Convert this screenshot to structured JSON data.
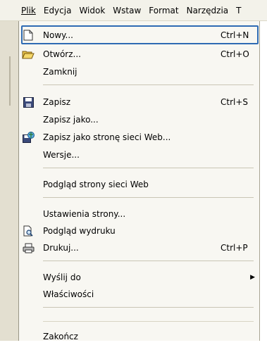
{
  "menubar": {
    "items": [
      "Plik",
      "Edycja",
      "Widok",
      "Wstaw",
      "Format",
      "Narzędzia",
      "T"
    ]
  },
  "menu": {
    "items": [
      {
        "label": "Nowy...",
        "shortcut": "Ctrl+N",
        "icon": "new-document-icon"
      },
      {
        "label": "Otwórz...",
        "shortcut": "Ctrl+O",
        "icon": "open-folder-icon"
      },
      {
        "label": "Zamknij",
        "shortcut": ""
      },
      {
        "label": "Zapisz",
        "shortcut": "Ctrl+S",
        "icon": "save-icon"
      },
      {
        "label": "Zapisz jako...",
        "shortcut": ""
      },
      {
        "label": "Zapisz jako stronę sieci Web...",
        "shortcut": "",
        "icon": "save-web-icon"
      },
      {
        "label": "Wersje...",
        "shortcut": ""
      },
      {
        "label": "Podgląd strony sieci Web",
        "shortcut": ""
      },
      {
        "label": "Ustawienia strony...",
        "shortcut": ""
      },
      {
        "label": "Podgląd wydruku",
        "shortcut": "",
        "icon": "print-preview-icon"
      },
      {
        "label": "Drukuj...",
        "shortcut": "Ctrl+P",
        "icon": "print-icon"
      },
      {
        "label": "Wyślij do",
        "shortcut": ""
      },
      {
        "label": "Właściwości",
        "shortcut": ""
      },
      {
        "label": "Zakończ",
        "shortcut": ""
      }
    ]
  }
}
